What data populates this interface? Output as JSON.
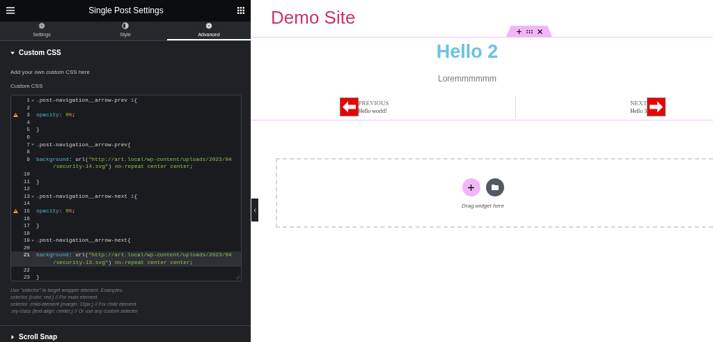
{
  "panel": {
    "title": "Single Post Settings",
    "tabs": [
      {
        "label": "Settings",
        "selected": false
      },
      {
        "label": "Style",
        "selected": false
      },
      {
        "label": "Advanced",
        "selected": true
      }
    ],
    "custom_css": {
      "title": "Custom CSS",
      "expanded": true,
      "description": "Add your own custom CSS here",
      "field_label": "Custom CSS",
      "code_lines": [
        {
          "number": "1",
          "fold": true,
          "parts": [
            {
              "kind": "selector",
              "text": ".post-navigation__arrow-prev "
            },
            {
              "kind": "keyword",
              "text": "i"
            },
            {
              "kind": "selector",
              "text": "{"
            }
          ]
        },
        {
          "number": "2"
        },
        {
          "number": "3",
          "warning": true,
          "parts": [
            {
              "kind": "keyword",
              "text": "opacity"
            },
            {
              "kind": "selector",
              "text": ": "
            },
            {
              "kind": "string",
              "text": "0"
            },
            {
              "kind": "unit",
              "text": "%"
            },
            {
              "kind": "selector",
              "text": ";"
            }
          ]
        },
        {
          "number": "4"
        },
        {
          "number": "5",
          "parts": [
            {
              "kind": "selector",
              "text": "}"
            }
          ]
        },
        {
          "number": "6"
        },
        {
          "number": "7",
          "fold": true,
          "parts": [
            {
              "kind": "selector",
              "text": ".post-navigation__arrow-prev{"
            }
          ]
        },
        {
          "number": "8"
        },
        {
          "number": "9",
          "parts": [
            {
              "kind": "keyword",
              "text": "background"
            },
            {
              "kind": "selector",
              "text": ": url("
            },
            {
              "kind": "string",
              "text": "\"http://art.local/wp-content/uploads/2023/04"
            }
          ],
          "wrap": [
            {
              "kind": "string",
              "text": "/security-14.svg\""
            },
            {
              "kind": "selector",
              "text": ") "
            },
            {
              "kind": "string",
              "text": "no-repeat center center"
            },
            {
              "kind": "selector",
              "text": ";"
            }
          ]
        },
        {
          "number": "10"
        },
        {
          "number": "11",
          "parts": [
            {
              "kind": "selector",
              "text": "}"
            }
          ]
        },
        {
          "number": "12"
        },
        {
          "number": "13",
          "fold": true,
          "parts": [
            {
              "kind": "selector",
              "text": ".post-navigation__arrow-next "
            },
            {
              "kind": "keyword",
              "text": "i"
            },
            {
              "kind": "selector",
              "text": "{"
            }
          ]
        },
        {
          "number": "14"
        },
        {
          "number": "15",
          "warning": true,
          "parts": [
            {
              "kind": "keyword",
              "text": "opacity"
            },
            {
              "kind": "selector",
              "text": ": "
            },
            {
              "kind": "string",
              "text": "0"
            },
            {
              "kind": "unit",
              "text": "%"
            },
            {
              "kind": "selector",
              "text": ";"
            }
          ]
        },
        {
          "number": "16"
        },
        {
          "number": "17",
          "parts": [
            {
              "kind": "selector",
              "text": "}"
            }
          ]
        },
        {
          "number": "18"
        },
        {
          "number": "19",
          "fold": true,
          "parts": [
            {
              "kind": "selector",
              "text": ".post-navigation__arrow-next{"
            }
          ]
        },
        {
          "number": "20"
        },
        {
          "number": "21",
          "active": true,
          "parts": [
            {
              "kind": "keyword",
              "text": "background"
            },
            {
              "kind": "selector",
              "text": ": url("
            },
            {
              "kind": "string",
              "text": "\"http://art.local/wp-content/uploads/2023/04"
            }
          ],
          "wrap": [
            {
              "kind": "string",
              "text": "/security-13.svg\""
            },
            {
              "kind": "selector",
              "text": ") "
            },
            {
              "kind": "string",
              "text": "no-repeat center center"
            },
            {
              "kind": "selector",
              "text": ";"
            }
          ]
        },
        {
          "number": "22"
        },
        {
          "number": "23",
          "parts": [
            {
              "kind": "selector",
              "text": "}"
            }
          ]
        }
      ],
      "help_lines": [
        "Use \"selector\" to target wrapper element. Examples:",
        "selector {color: red;} // For main element",
        "selector .child-element {margin: 10px;} // For child element",
        ".my-class {text-align: center;} // Or use any custom selector"
      ]
    },
    "scroll_snap": {
      "title": "Scroll Snap",
      "expanded": false
    }
  },
  "canvas": {
    "site_title": "Demo Site",
    "post_title": "Hello 2",
    "excerpt": "Loremmmmmm",
    "previous": {
      "label": "PREVIOUS",
      "title": "Hello world!"
    },
    "next": {
      "label": "NEXT",
      "title": "Hello 3"
    },
    "drop_hint": "Drag widget here"
  }
}
